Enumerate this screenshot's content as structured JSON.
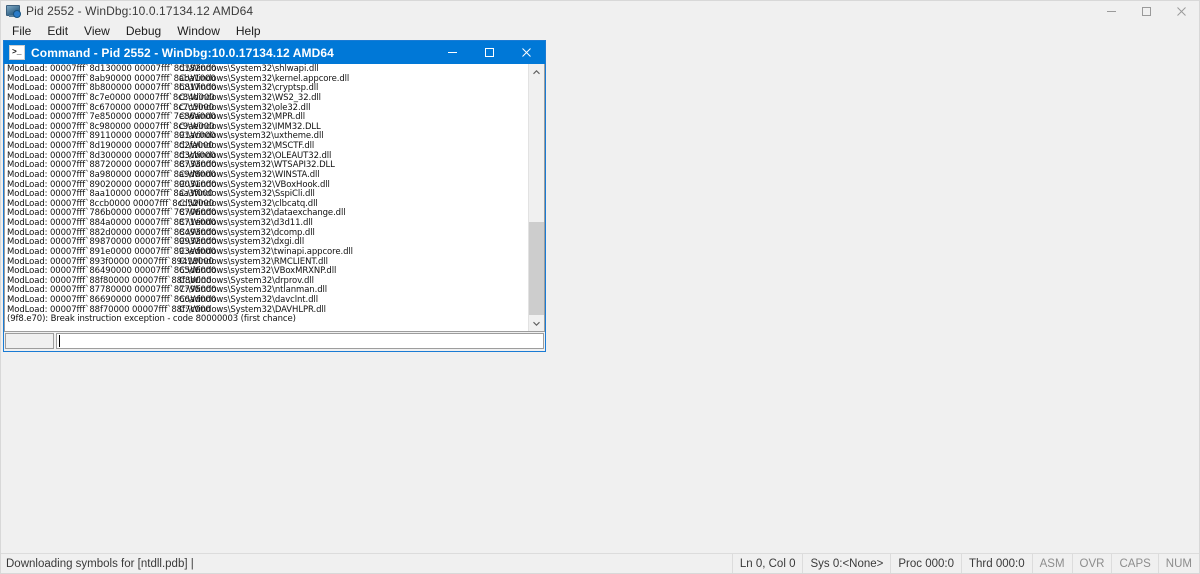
{
  "app": {
    "icon": "debugger-monitor-icon",
    "title": "Pid 2552 - WinDbg:10.0.17134.12 AMD64",
    "window_controls": {
      "minimize": "minimize-icon",
      "maximize": "maximize-icon",
      "close": "close-icon"
    }
  },
  "menu": {
    "items": [
      {
        "label": "File"
      },
      {
        "label": "Edit"
      },
      {
        "label": "View"
      },
      {
        "label": "Debug"
      },
      {
        "label": "Window"
      },
      {
        "label": "Help"
      }
    ]
  },
  "command_window": {
    "icon": "console-prompt-icon",
    "title": "Command - Pid 2552 - WinDbg:10.0.17134.12 AMD64",
    "title_bar_color": "#0078d7",
    "window_controls": {
      "minimize": "minimize-icon",
      "maximize": "maximize-icon",
      "close": "close-icon"
    },
    "output_lines": [
      {
        "left": "ModLoad: 00007fff`8d130000 00007fff`8d182000",
        "right": "C:\\Windows\\System32\\shlwapi.dll"
      },
      {
        "left": "ModLoad: 00007fff`8ab90000 00007fff`8aba1000",
        "right": "C:\\Windows\\System32\\kernel.appcore.dll"
      },
      {
        "left": "ModLoad: 00007fff`8b800000 00007fff`8b817000",
        "right": "C:\\Windows\\System32\\cryptsp.dll"
      },
      {
        "left": "ModLoad: 00007fff`8c7e0000 00007fff`8c84d000",
        "right": "C:\\Windows\\System32\\WS2_32.dll"
      },
      {
        "left": "ModLoad: 00007fff`8c670000 00007fff`8c7c5000",
        "right": "C:\\Windows\\System32\\ole32.dll"
      },
      {
        "left": "ModLoad: 00007fff`7e850000 00007fff`7e86a000",
        "right": "C:\\Windows\\System32\\MPR.dll"
      },
      {
        "left": "ModLoad: 00007fff`8c980000 00007fff`8c9ae000",
        "right": "C:\\Windows\\System32\\IMM32.DLL"
      },
      {
        "left": "ModLoad: 00007fff`89110000 00007fff`891ac000",
        "right": "C:\\Windows\\system32\\uxtheme.dll"
      },
      {
        "left": "ModLoad: 00007fff`8d190000 00007fff`8d2fa000",
        "right": "C:\\Windows\\System32\\MSCTF.dll"
      },
      {
        "left": "ModLoad: 00007fff`8d300000 00007fff`8d3cb000",
        "right": "C:\\Windows\\System32\\OLEAUT32.dll"
      },
      {
        "left": "ModLoad: 00007fff`88720000 00007fff`88733000",
        "right": "C:\\Windows\\system32\\WTSAPI32.DLL"
      },
      {
        "left": "ModLoad: 00007fff`8a980000 00007fff`8a9d8000",
        "right": "C:\\Windows\\System32\\WINSTA.dll"
      },
      {
        "left": "ModLoad: 00007fff`89020000 00007fff`89031000",
        "right": "C:\\Windows\\System32\\VBoxHook.dll"
      },
      {
        "left": "ModLoad: 00007fff`8aa10000 00007fff`8aa3f000",
        "right": "C:\\Windows\\System32\\SspiCli.dll"
      },
      {
        "left": "ModLoad: 00007fff`8ccb0000 00007fff`8cd52000",
        "right": "C:\\Windows\\System32\\clbcatq.dll"
      },
      {
        "left": "ModLoad: 00007fff`786b0000 00007fff`78706000",
        "right": "C:\\Windows\\system32\\dataexchange.dll"
      },
      {
        "left": "ModLoad: 00007fff`884a0000 00007fff`8871e000",
        "right": "C:\\Windows\\system32\\d3d11.dll"
      },
      {
        "left": "ModLoad: 00007fff`882d0000 00007fff`88493000",
        "right": "C:\\Windows\\system32\\dcomp.dll"
      },
      {
        "left": "ModLoad: 00007fff`89870000 00007fff`89932000",
        "right": "C:\\Windows\\system32\\dxgi.dll"
      },
      {
        "left": "ModLoad: 00007fff`891e0000 00007fff`893ed000",
        "right": "C:\\Windows\\system32\\twinapi.appcore.dll"
      },
      {
        "left": "ModLoad: 00007fff`893f0000 00007fff`89418000",
        "right": "C:\\Windows\\system32\\RMCLIENT.dll"
      },
      {
        "left": "ModLoad: 00007fff`86490000 00007fff`865d6000",
        "right": "C:\\Windows\\system32\\VBoxMRXNP.dll"
      },
      {
        "left": "ModLoad: 00007fff`88f80000 00007fff`88f8b000",
        "right": "C:\\Windows\\System32\\drprov.dll"
      },
      {
        "left": "ModLoad: 00007fff`87780000 00007fff`87795000",
        "right": "C:\\Windows\\System32\\ntlanman.dll"
      },
      {
        "left": "ModLoad: 00007fff`86690000 00007fff`866ad000",
        "right": "C:\\Windows\\System32\\davclnt.dll"
      },
      {
        "left": "ModLoad: 00007fff`88f70000 00007fff`88f7c000",
        "right": "C:\\Windows\\System32\\DAVHLPR.dll"
      },
      {
        "left": "(9f8.e70): Break instruction exception - code 80000003 (first chance)",
        "right": ""
      }
    ],
    "scrollbar": {
      "up_arrow": "chevron-up-icon",
      "down_arrow": "chevron-down-icon"
    },
    "prompt_box_value": "",
    "input_value": "",
    "input_placeholder": ""
  },
  "status_bar": {
    "message": "Downloading symbols for [ntdll.pdb] |",
    "panes": [
      {
        "label": "Ln 0, Col 0",
        "dim": false
      },
      {
        "label": "Sys 0:<None>",
        "dim": false
      },
      {
        "label": "Proc 000:0",
        "dim": false
      },
      {
        "label": "Thrd 000:0",
        "dim": false
      },
      {
        "label": "ASM",
        "dim": true
      },
      {
        "label": "OVR",
        "dim": true
      },
      {
        "label": "CAPS",
        "dim": true
      },
      {
        "label": "NUM",
        "dim": true
      }
    ]
  }
}
